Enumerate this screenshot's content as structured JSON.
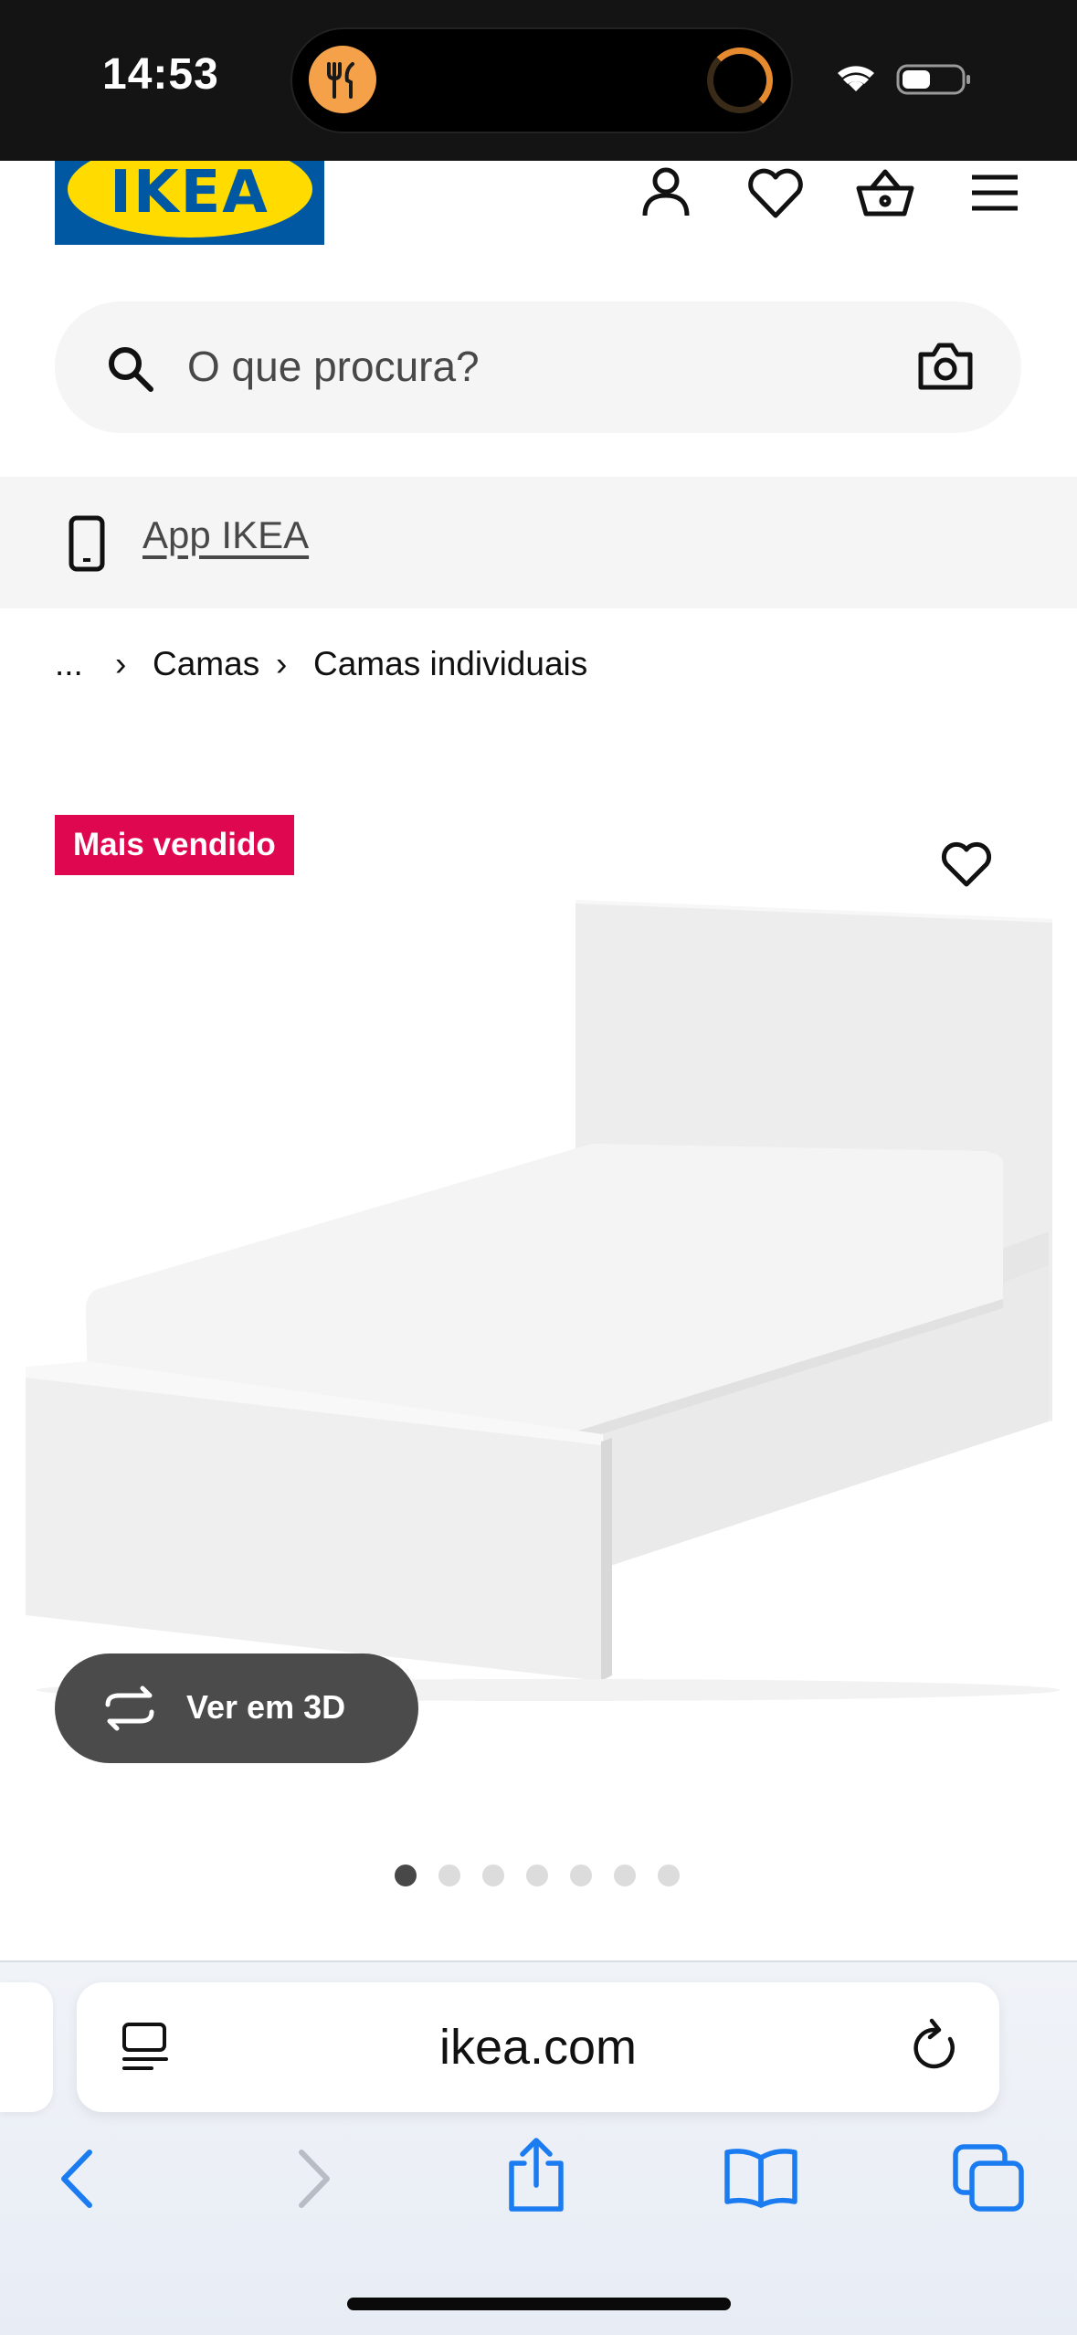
{
  "status_bar": {
    "time": "14:53",
    "icons": [
      "food-activity-icon",
      "progress-ring-icon",
      "wifi-icon",
      "battery-icon"
    ]
  },
  "header": {
    "logo_text": "IKEA",
    "icons": [
      "account-icon",
      "heart-icon",
      "basket-icon",
      "menu-icon"
    ]
  },
  "search": {
    "placeholder": "O que procura?",
    "icons": [
      "search-icon",
      "camera-icon"
    ]
  },
  "app_banner": {
    "label": "App IKEA",
    "icon": "phone-icon"
  },
  "breadcrumb": {
    "items": [
      "...",
      "Camas",
      "Camas individuais"
    ]
  },
  "product": {
    "badge": "Mais vendido",
    "view_3d_label": "Ver em 3D",
    "image_count": 7,
    "active_image_index": 1
  },
  "browser": {
    "url": "ikea.com",
    "icons": [
      "reader-icon",
      "reload-icon",
      "back-icon",
      "forward-icon",
      "share-icon",
      "bookmarks-icon",
      "tabs-icon"
    ]
  },
  "colors": {
    "ikea_blue": "#0058a3",
    "ikea_yellow": "#ffdb00",
    "badge_red": "#e00751",
    "safari_blue": "#1a7cf0"
  }
}
